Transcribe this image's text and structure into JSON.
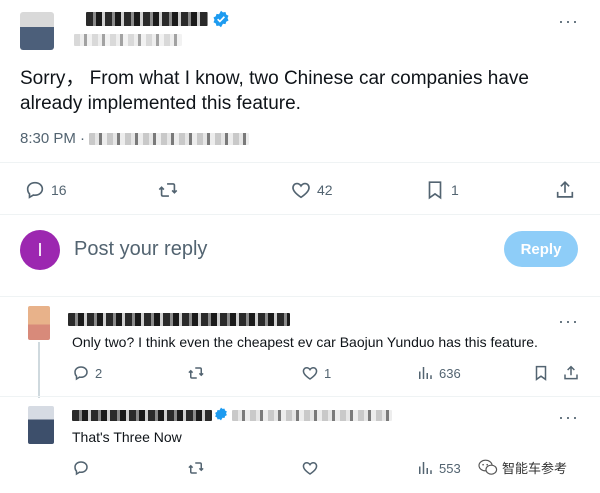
{
  "main_tweet": {
    "handle": "@tesladshanghai",
    "text": "Sorry， From what I know, two Chinese car companies have already implemented this feature.",
    "time": "8:30 PM ·",
    "actions": {
      "replies": "16",
      "likes": "42",
      "bookmarks": "1"
    }
  },
  "reply_box": {
    "avatar_letter": "I",
    "placeholder": "Post your reply",
    "button": "Reply",
    "avatar_color": "#9c27b0",
    "button_color": "#8ecdf8"
  },
  "replies": [
    {
      "text": "Only two? I think even the cheapest ev car Baojun Yunduo has this feature.",
      "replies": "2",
      "likes": "1",
      "views": "636"
    },
    {
      "text": "That's Three Now",
      "views": "553"
    }
  ],
  "watermark": "智能车参考",
  "colors": {
    "icon_gray": "#536471",
    "verified_blue": "#1d9bf0"
  }
}
